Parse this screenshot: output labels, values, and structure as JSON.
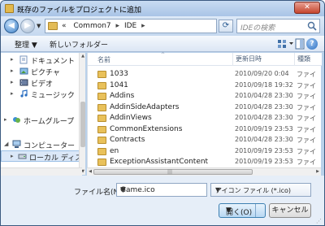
{
  "window": {
    "title": "既存のファイルをプロジェクトに追加",
    "close_label": "✕"
  },
  "address": {
    "prefix": "«",
    "segments": [
      "Common7",
      "IDE"
    ],
    "separator": "▸"
  },
  "search": {
    "placeholder": "IDEの検索"
  },
  "toolbar": {
    "organize_label": "整理 ▼",
    "new_folder_label": "新しいフォルダー",
    "help_label": "?"
  },
  "nav_pane": {
    "items": [
      {
        "label": "ドキュメント",
        "icon": "documents-icon"
      },
      {
        "label": "ピクチャ",
        "icon": "pictures-icon"
      },
      {
        "label": "ビデオ",
        "icon": "videos-icon"
      },
      {
        "label": "ミュージック",
        "icon": "music-icon"
      },
      {
        "label": "ホームグループ",
        "icon": "homegroup-icon"
      },
      {
        "label": "コンピューター",
        "icon": "computer-icon"
      },
      {
        "label": "ローカル ディス",
        "icon": "drive-icon"
      }
    ]
  },
  "columns": {
    "name": "名前",
    "date": "更新日時",
    "type": "種類"
  },
  "files": [
    {
      "name": "1033",
      "date": "2010/09/20 0:04",
      "type": "ファイ"
    },
    {
      "name": "1041",
      "date": "2010/09/18 19:32",
      "type": "ファイ"
    },
    {
      "name": "Addins",
      "date": "2010/04/28 23:30",
      "type": "ファイ"
    },
    {
      "name": "AddinSideAdapters",
      "date": "2010/04/28 23:30",
      "type": "ファイ"
    },
    {
      "name": "AddinViews",
      "date": "2010/04/28 23:30",
      "type": "ファイ"
    },
    {
      "name": "CommonExtensions",
      "date": "2010/09/19 23:53",
      "type": "ファイ"
    },
    {
      "name": "Contracts",
      "date": "2010/04/28 23:30",
      "type": "ファイ"
    },
    {
      "name": "en",
      "date": "2010/09/19 23:53",
      "type": "ファイ"
    },
    {
      "name": "ExceptionAssistantContent",
      "date": "2010/09/19 23:53",
      "type": "ファイ"
    }
  ],
  "footer": {
    "filename_label": "ファイル名(N):",
    "filename_value": "Game.ico",
    "filetype_value": "アイコン ファイル (*.ico)",
    "open_label": "開く(O)",
    "cancel_label": "キャンセル"
  }
}
